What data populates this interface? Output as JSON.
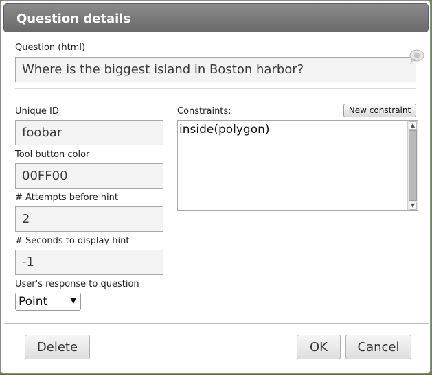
{
  "dialog": {
    "title": "Question details"
  },
  "question": {
    "label": "Question (html)",
    "value": "Where is the biggest island in Boston harbor?"
  },
  "fields": {
    "unique_id": {
      "label": "Unique ID",
      "value": "foobar"
    },
    "tool_button_color": {
      "label": "Tool button color",
      "value": "00FF00"
    },
    "attempts_before_hint": {
      "label": "# Attempts before hint",
      "value": "2"
    },
    "seconds_to_display_hint": {
      "label": "# Seconds to display hint",
      "value": "-1"
    },
    "users_response": {
      "label": "User's response to question",
      "selected": "Point"
    }
  },
  "constraints": {
    "label": "Constraints:",
    "new_button": "New constraint",
    "value": "inside(polygon)"
  },
  "footer": {
    "delete": "Delete",
    "ok": "OK",
    "cancel": "Cancel"
  },
  "icons": {
    "question_help": "speech-bubble-icon",
    "select_arrow": "caret-down-icon",
    "scroll_up": "scroll-up-icon",
    "scroll_down": "scroll-down-icon"
  },
  "colors": {
    "titlebar": "#7a7a7a",
    "background": "#6f8a4a"
  }
}
